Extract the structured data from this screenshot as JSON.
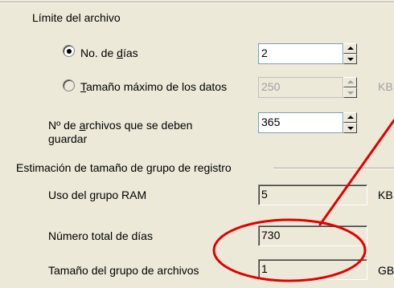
{
  "file_limit": {
    "heading": "Límite del archivo",
    "days_option": {
      "prefix": "No. de ",
      "mnemonic": "d",
      "suffix": "ías",
      "checked": true
    },
    "size_option": {
      "mnemonic": "T",
      "suffix": "amaño máximo de los datos",
      "checked": false
    },
    "days_value": "2",
    "size_value": "250",
    "size_unit": "KB",
    "files_label": {
      "line1_prefix": "Nº de ",
      "mnemonic": "a",
      "line1_suffix": "rchivos que se deben",
      "line2": "guardar"
    },
    "files_value": "365"
  },
  "estimation": {
    "heading": "Estimación de tamaño de grupo de registro",
    "ram_label": "Uso del grupo RAM",
    "ram_value": "5",
    "ram_unit": "KB",
    "days_total_label": "Número total de días",
    "days_total_value": "730",
    "group_size_label": "Tamaño del grupo de archivos",
    "group_size_value": "1",
    "group_size_unit": "GB"
  },
  "annotation": {
    "color": "#e00000"
  }
}
